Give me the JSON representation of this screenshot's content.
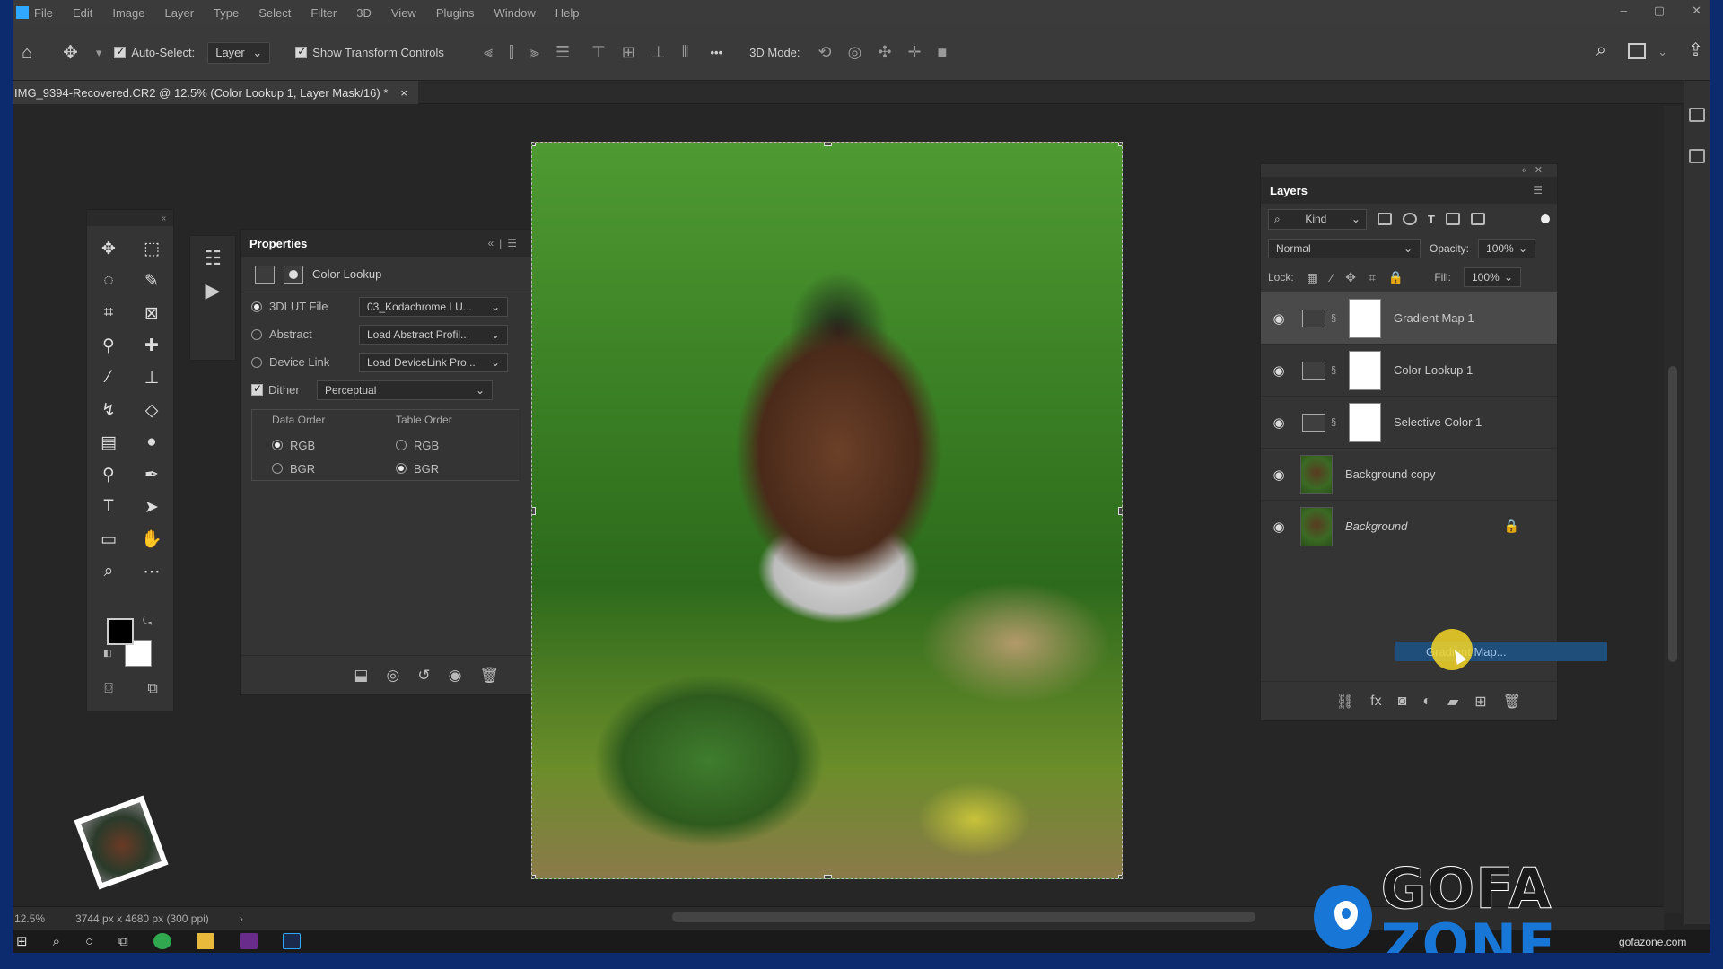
{
  "menu": {
    "items": [
      "File",
      "Edit",
      "Image",
      "Layer",
      "Type",
      "Select",
      "Filter",
      "3D",
      "View",
      "Plugins",
      "Window",
      "Help"
    ],
    "window_controls": [
      "–",
      "▢",
      "✕"
    ]
  },
  "options_bar": {
    "auto_select_label": "Auto-Select:",
    "auto_select_target": "Layer",
    "show_transform_label": "Show Transform Controls",
    "more_label": "•••",
    "mode_3d_label": "3D Mode:"
  },
  "document": {
    "tab_title": "IMG_9394-Recovered.CR2 @ 12.5% (Color Lookup 1, Layer Mask/16) *",
    "close_glyph": "×"
  },
  "properties": {
    "tab": "Properties",
    "adjustment_name": "Color Lookup",
    "rows": [
      {
        "label": "3DLUT File",
        "value": "03_Kodachrome  LU...",
        "selected": true
      },
      {
        "label": "Abstract",
        "value": "Load Abstract Profil...",
        "selected": false
      },
      {
        "label": "Device Link",
        "value": "Load DeviceLink Pro...",
        "selected": false
      }
    ],
    "dither_label": "Dither",
    "dither_value": "Perceptual",
    "data_order_label": "Data Order",
    "table_order_label": "Table Order",
    "data_order_options": [
      "RGB",
      "BGR"
    ],
    "table_order_options": [
      "RGB",
      "BGR"
    ]
  },
  "layers": {
    "tab": "Layers",
    "filter_kind": "Kind",
    "blend_mode": "Normal",
    "opacity_label": "Opacity:",
    "opacity_value": "100%",
    "lock_label": "Lock:",
    "fill_label": "Fill:",
    "fill_value": "100%",
    "items": [
      {
        "name": "Gradient Map 1"
      },
      {
        "name": "Color Lookup 1"
      },
      {
        "name": "Selective Color 1"
      },
      {
        "name": "Background copy"
      },
      {
        "name": "Background"
      }
    ],
    "drag_tooltip": "Gradient Map..."
  },
  "status": {
    "zoom": "12.5%",
    "doc_info": "3744 px x 4680 px (300 ppi)"
  },
  "watermark": {
    "brand_left": "GOFA",
    "brand_right": "ZONE",
    "url": "gofazone.com"
  },
  "colors": {
    "accent_blue": "#31a8ff",
    "panel": "#343434",
    "background": "#262626",
    "watermark_blue": "#1877d6"
  }
}
